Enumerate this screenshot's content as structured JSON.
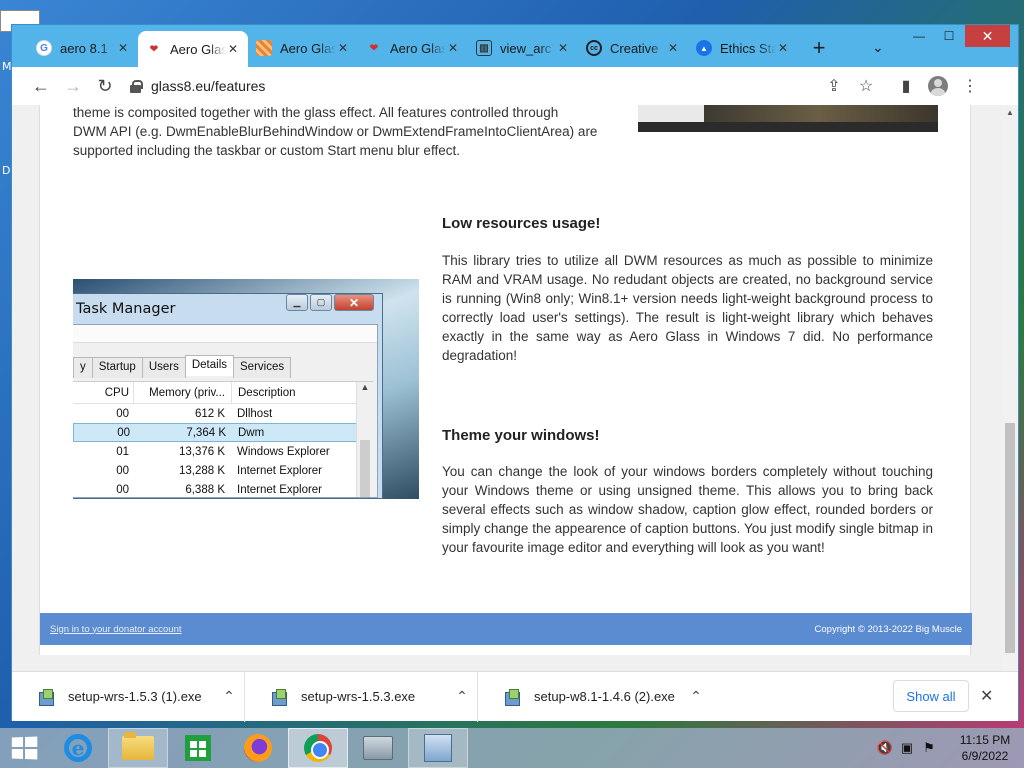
{
  "browser": {
    "tabs": [
      {
        "title": "aero 8.1",
        "favicon": "google-icon",
        "favicon_color": "#4285f4"
      },
      {
        "title": "Aero Glass",
        "favicon": "aero-heart-icon",
        "favicon_color": "#d32f2f",
        "active": true
      },
      {
        "title": "Aero Glass",
        "favicon": "aero-stripes-icon",
        "favicon_color": "#e8833a"
      },
      {
        "title": "Aero Glass",
        "favicon": "aero-heart-icon",
        "favicon_color": "#d32f2f"
      },
      {
        "title": "view_arc",
        "favicon": "archive-icon",
        "favicon_color": "#333333"
      },
      {
        "title": "Creative",
        "favicon": "cc-icon",
        "favicon_color": "#222222"
      },
      {
        "title": "Ethics Sta",
        "favicon": "ethics-icon",
        "favicon_color": "#1a73e8"
      }
    ],
    "new_tab": "+",
    "tab_search": "⌄",
    "window_controls": {
      "minimize": "—",
      "maximize": "☐",
      "close": "✕"
    },
    "url": "glass8.eu/features",
    "nav": {
      "back": "←",
      "forward": "→",
      "reload": "↻"
    },
    "toolbar_icons": {
      "share": "⇪",
      "bookmark": "☆",
      "sidepanel": "▮",
      "menu": "⋮"
    }
  },
  "page": {
    "intro_lines": [
      "theme is composited together with the glass effect. All features controlled through",
      "DWM API (e.g. DwmEnableBlurBehindWindow or DwmExtendFrameIntoClientArea) are",
      "supported including the taskbar or custom Start menu blur effect."
    ],
    "section1": {
      "title": "Low resources usage!",
      "body": "This library tries to utilize all DWM resources as much as possible to minimize RAM and VRAM usage. No redudant objects are created, no background service is running (Win8 only; Win8.1+ version needs light-weight background process to correctly load user's settings). The result is light-weight library which behaves exactly in the same way as Aero Glass in Windows 7 did. No performance degradation!"
    },
    "section2": {
      "title": "Theme your windows!",
      "body": "You can change the look of your windows borders completely without touching your Windows theme or using unsigned theme. This allows you to bring back several effects such as window shadow, caption glow effect, rounded borders or simply change the appearence of caption buttons. You just modify single bitmap in your favourite image editor and everything will look as you want!"
    },
    "taskmanager": {
      "title": "Task Manager",
      "tabs": [
        "y",
        "Startup",
        "Users",
        "Details",
        "Services"
      ],
      "active_tab": "Details",
      "columns": {
        "cpu": "CPU",
        "memory": "Memory (priv...",
        "description": "Description"
      },
      "rows": [
        {
          "cpu": "00",
          "memory": "612 K",
          "description": "Dllhost"
        },
        {
          "cpu": "00",
          "memory": "7,364 K",
          "description": "Dwm",
          "selected": true
        },
        {
          "cpu": "01",
          "memory": "13,376 K",
          "description": "Windows Explorer"
        },
        {
          "cpu": "00",
          "memory": "13,288 K",
          "description": "Internet Explorer"
        },
        {
          "cpu": "00",
          "memory": "6,388 K",
          "description": "Internet Explorer"
        }
      ]
    },
    "footer": {
      "link": "Sign in to your donator account",
      "copyright": "Copyright © 2013-2022 Big Muscle",
      "color": "#5b8bd0"
    }
  },
  "downloads": {
    "items": [
      {
        "name": "setup-wrs-1.5.3 (1).exe"
      },
      {
        "name": "setup-wrs-1.5.3.exe"
      },
      {
        "name": "setup-w8.1-1.4.6 (2).exe"
      }
    ],
    "show_all": "Show all",
    "close": "✕"
  },
  "taskbar": {
    "clock_time": "11:15 PM",
    "clock_date": "6/9/2022",
    "tray": {
      "volume": "🔇",
      "network": "▣",
      "flag": "⚑"
    }
  },
  "desktop": {
    "letters": [
      "M",
      "D"
    ]
  }
}
